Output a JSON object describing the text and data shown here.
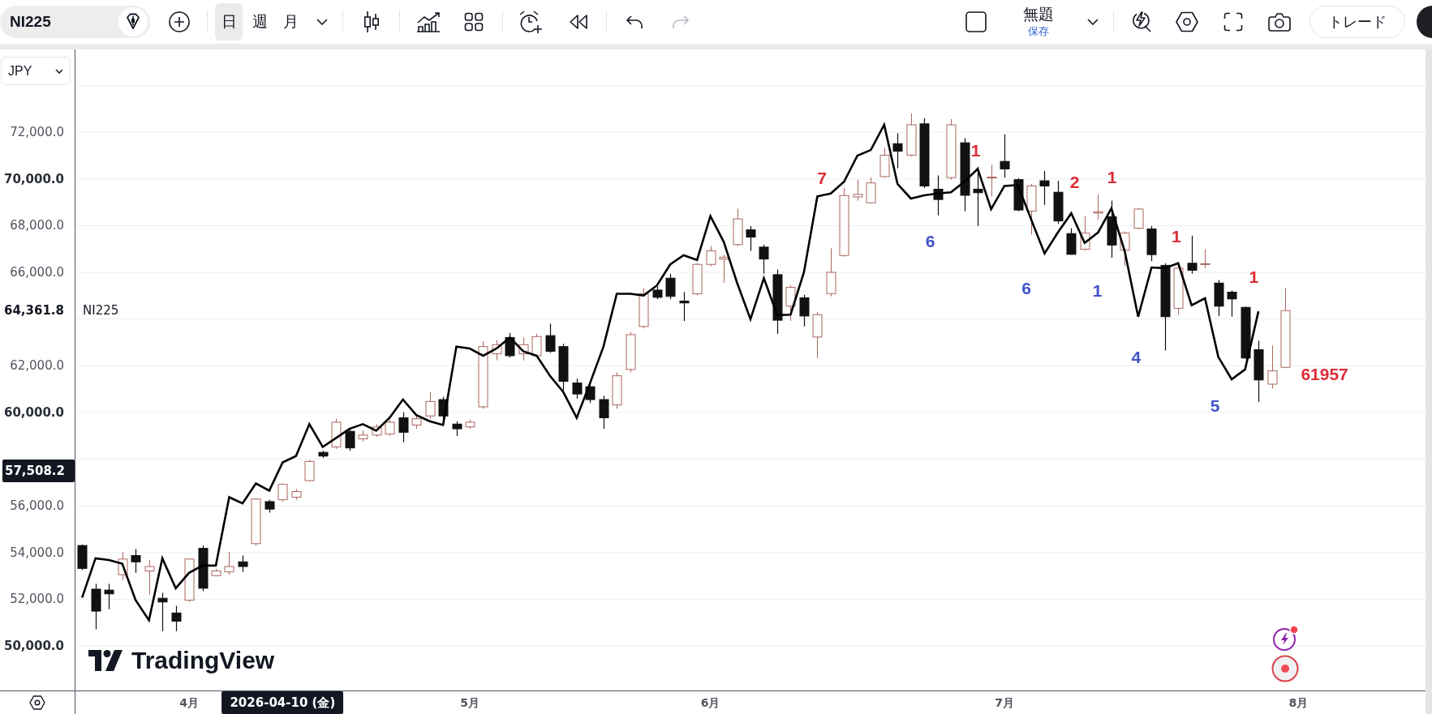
{
  "toolbar": {
    "symbol": "NI225",
    "intervals": [
      {
        "label": "日",
        "selected": true
      },
      {
        "label": "週",
        "selected": false
      },
      {
        "label": "月",
        "selected": false
      }
    ],
    "undo": {
      "disabled": false
    },
    "redo": {
      "disabled": true
    },
    "layout_name": "無題",
    "save_status": "保存",
    "trade_button": "トレード"
  },
  "price_axis": {
    "currency": "JPY",
    "last_price": "64,361.8",
    "crosshair_price": "57,508.2"
  },
  "time_axis": {
    "crosshair_date": "2026-04-10 (金)"
  },
  "chart": {
    "series_label": "NI225",
    "logo": "TradingView",
    "chart_data": {
      "type": "candlestick",
      "grid": true,
      "ylim": [
        48090,
        75547
      ],
      "yticks": [
        {
          "value": 72000,
          "label": "72,000.0"
        },
        {
          "value": 70000,
          "label": "70,000.0"
        },
        {
          "value": 68000,
          "label": "68,000.0"
        },
        {
          "value": 66000,
          "label": "66,000.0"
        },
        {
          "value": 62000,
          "label": "62,000.0"
        },
        {
          "value": 60000,
          "label": "60,000.0"
        },
        {
          "value": 56000,
          "label": "56,000.0"
        },
        {
          "value": 54000,
          "label": "54,000.0"
        },
        {
          "value": 52000,
          "label": "52,000.0"
        },
        {
          "value": 50000,
          "label": "50,000.0"
        }
      ],
      "categories": [
        null,
        null,
        null,
        null,
        null,
        null,
        null,
        null,
        "4月",
        null,
        null,
        null,
        null,
        null,
        null,
        null,
        null,
        null,
        null,
        null,
        null,
        null,
        null,
        null,
        null,
        null,
        null,
        null,
        null,
        "5月",
        null,
        null,
        null,
        null,
        null,
        null,
        null,
        null,
        null,
        null,
        null,
        null,
        null,
        null,
        null,
        null,
        null,
        "6月",
        null,
        null,
        null,
        null,
        null,
        null,
        null,
        null,
        null,
        null,
        null,
        null,
        null,
        null,
        null,
        null,
        null,
        null,
        null,
        null,
        null,
        "7月",
        null,
        null,
        null,
        null,
        null,
        null,
        null,
        null,
        null,
        null,
        null,
        null,
        null,
        null,
        null,
        null,
        null,
        null,
        null,
        null,
        null,
        "8月",
        null,
        null,
        null,
        null,
        null,
        null,
        null,
        null,
        null
      ],
      "ohlc": [
        [
          54300,
          54340,
          53250,
          53320
        ],
        [
          52430,
          52660,
          50710,
          51490
        ],
        [
          52390,
          52660,
          51570,
          52230
        ],
        [
          53050,
          54030,
          52820,
          53720
        ],
        [
          53870,
          54150,
          53130,
          53600
        ],
        [
          53210,
          53680,
          52190,
          53400
        ],
        [
          52040,
          52270,
          50630,
          51880
        ],
        [
          51410,
          51720,
          50630,
          51060
        ],
        [
          51960,
          53750,
          51880,
          53720
        ],
        [
          54180,
          54300,
          52350,
          52470
        ],
        [
          53010,
          53290,
          52970,
          53210
        ],
        [
          53170,
          54030,
          53050,
          53400
        ],
        [
          53600,
          53870,
          53170,
          53400
        ],
        [
          54380,
          56330,
          54300,
          56290
        ],
        [
          56180,
          56260,
          55710,
          55860
        ],
        [
          56260,
          56960,
          56180,
          56920
        ],
        [
          56370,
          56720,
          56260,
          56610
        ],
        [
          57080,
          57970,
          57040,
          57900
        ],
        [
          58290,
          58360,
          58050,
          58130
        ],
        [
          58520,
          59730,
          58440,
          59580
        ],
        [
          59190,
          59300,
          58360,
          58480
        ],
        [
          58870,
          59220,
          58760,
          59030
        ],
        [
          59030,
          59500,
          58950,
          59380
        ],
        [
          59070,
          59690,
          58990,
          59580
        ],
        [
          59770,
          60010,
          58720,
          59150
        ],
        [
          59460,
          59890,
          59300,
          59730
        ],
        [
          59850,
          60860,
          59730,
          60470
        ],
        [
          60550,
          60670,
          59690,
          59850
        ],
        [
          59500,
          59620,
          58990,
          59300
        ],
        [
          59380,
          59690,
          59300,
          59580
        ],
        [
          60240,
          63050,
          60160,
          62820
        ],
        [
          62510,
          63090,
          62230,
          62900
        ],
        [
          63210,
          63400,
          62350,
          62430
        ],
        [
          62510,
          63210,
          62230,
          62900
        ],
        [
          62430,
          63370,
          62350,
          63250
        ],
        [
          63290,
          63800,
          62550,
          62620
        ],
        [
          62820,
          62940,
          60940,
          61330
        ],
        [
          61260,
          61450,
          60590,
          60790
        ],
        [
          61100,
          61260,
          60400,
          60550
        ],
        [
          60550,
          60710,
          59300,
          59770
        ],
        [
          60320,
          61720,
          60160,
          61570
        ],
        [
          61840,
          63440,
          61720,
          63330
        ],
        [
          63680,
          65320,
          63600,
          65080
        ],
        [
          65240,
          65400,
          64850,
          64930
        ],
        [
          65750,
          65940,
          64850,
          64970
        ],
        [
          64770,
          65160,
          63910,
          64690
        ],
        [
          65080,
          66410,
          65010,
          66340
        ],
        [
          66340,
          67120,
          66260,
          66920
        ],
        [
          66570,
          66760,
          65550,
          66650
        ],
        [
          67190,
          68720,
          67120,
          68290
        ],
        [
          67820,
          67980,
          66920,
          67510
        ],
        [
          67080,
          67190,
          65940,
          66570
        ],
        [
          65900,
          66120,
          63370,
          63950
        ],
        [
          64550,
          65450,
          63920,
          65360
        ],
        [
          64910,
          65040,
          63680,
          64130
        ],
        [
          63230,
          64310,
          62330,
          64190
        ],
        [
          65090,
          67030,
          64970,
          66000
        ],
        [
          66720,
          69610,
          66670,
          69290
        ],
        [
          69230,
          69970,
          69070,
          69340
        ],
        [
          68980,
          70060,
          68940,
          69830
        ],
        [
          70100,
          71330,
          70060,
          71020
        ],
        [
          71510,
          71960,
          70460,
          71190
        ],
        [
          71020,
          72810,
          70970,
          72320
        ],
        [
          72360,
          72600,
          69610,
          69700
        ],
        [
          69560,
          70150,
          68440,
          69120
        ],
        [
          70060,
          72560,
          69970,
          72320
        ],
        [
          71550,
          71750,
          68620,
          69300
        ],
        [
          69560,
          70520,
          67990,
          69410
        ],
        [
          70060,
          70610,
          69250,
          70080
        ],
        [
          70750,
          71910,
          70060,
          70430
        ],
        [
          69970,
          70030,
          68620,
          68670
        ],
        [
          68620,
          69790,
          67620,
          69700
        ],
        [
          69920,
          70340,
          68890,
          69700
        ],
        [
          69430,
          69920,
          68080,
          68200
        ],
        [
          67660,
          67890,
          66760,
          66770
        ],
        [
          66990,
          68400,
          66950,
          67680
        ],
        [
          68540,
          69340,
          68260,
          68590
        ],
        [
          68380,
          69070,
          66630,
          67170
        ],
        [
          66950,
          67750,
          66270,
          67680
        ],
        [
          67890,
          68760,
          67840,
          68710
        ],
        [
          67860,
          67990,
          66480,
          66760
        ],
        [
          66300,
          66390,
          62650,
          64100
        ],
        [
          64460,
          66270,
          64190,
          66180
        ],
        [
          66390,
          67570,
          65940,
          66090
        ],
        [
          66340,
          66990,
          66180,
          66370
        ],
        [
          65540,
          65670,
          64130,
          64550
        ],
        [
          65150,
          65220,
          64100,
          64860
        ],
        [
          64500,
          64530,
          62290,
          62330
        ],
        [
          62690,
          63070,
          60450,
          61390
        ],
        [
          61210,
          62870,
          61020,
          61780
        ],
        [
          61930,
          65330,
          61890,
          64361.8
        ],
        null,
        null,
        null,
        null,
        null,
        null,
        null,
        null,
        null,
        null
      ],
      "series": [
        {
          "type": "line",
          "color": "#000000",
          "values": [
            52070,
            53750,
            53680,
            53520,
            51960,
            51100,
            53750,
            52470,
            53130,
            53440,
            53440,
            56370,
            56100,
            56960,
            56650,
            57860,
            58130,
            59500,
            58520,
            58910,
            59300,
            59500,
            59220,
            59770,
            60550,
            59890,
            59620,
            59460,
            62820,
            62740,
            62430,
            62740,
            63210,
            62620,
            62430,
            61570,
            60870,
            59770,
            61260,
            62820,
            65080,
            65080,
            65010,
            65440,
            66340,
            66730,
            66530,
            68410,
            67310,
            65550,
            63990,
            65750,
            64170,
            64190,
            66000,
            69250,
            69380,
            69880,
            71000,
            71240,
            72320,
            69790,
            69160,
            69300,
            69380,
            69430,
            69880,
            70430,
            68710,
            69700,
            69740,
            68260,
            66810,
            67710,
            68530,
            67260,
            67710,
            68740,
            66900,
            64100,
            66210,
            66180,
            66390,
            64590,
            64890,
            62380,
            61420,
            61840,
            64330,
            null,
            null,
            null,
            null,
            null,
            null,
            null,
            null,
            null,
            null,
            null,
            null
          ]
        }
      ],
      "annotations": [
        "7",
        "6",
        "1",
        "6",
        "2",
        "1",
        "1",
        "4",
        "1",
        "5",
        "1",
        "61957"
      ]
    }
  }
}
